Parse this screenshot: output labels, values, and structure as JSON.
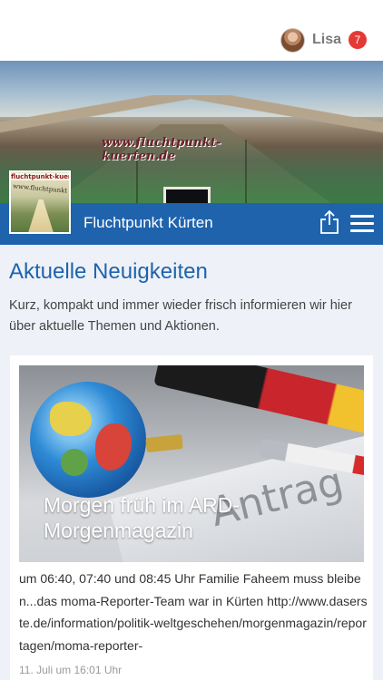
{
  "user": {
    "name": "Lisa",
    "notification_count": "7"
  },
  "banner": {
    "watermark_text": "www.fluchtpunkt-kuerten.de"
  },
  "header": {
    "site_name": "Fluchtpunkt Kürten",
    "share_icon": "share-icon",
    "menu_icon": "hamburger-menu-icon",
    "accent_color": "#1f63ad"
  },
  "logo": {
    "line1": "fluchtpunkt-kuerten",
    "line2": "www.fluchtpunkt-kuerten.de"
  },
  "main": {
    "title": "Aktuelle Neuigkeiten",
    "description": "Kurz, kompakt und immer wieder frisch informieren wir hier über aktuelle Themen und Aktionen."
  },
  "news": [
    {
      "image_text": "Antrag",
      "title": "Morgen früh im ARD-Morgenmagazin",
      "excerpt": "um 06:40, 07:40 und 08:45 Uhr Familie Faheem muss bleiben...das moma-Reporter-Team war in Kürten http://www.daserste.de/information/politik-weltgeschehen/morgenmagazin/reportagen/moma-reporter-",
      "date": "11. Juli um 16:01 Uhr"
    }
  ]
}
